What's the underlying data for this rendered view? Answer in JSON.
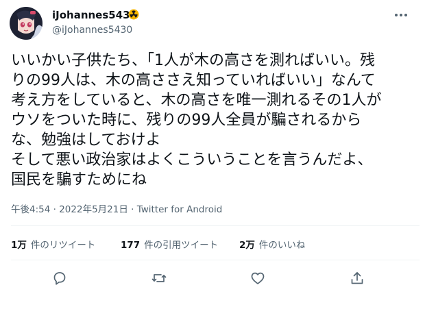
{
  "author": {
    "display_name": "iJohannes5430",
    "handle": "@iJohannes5430",
    "badge_icon": "radioactive-icon"
  },
  "tweet": {
    "lines": [
      "いいかい子供たち、「1人が木の高さを測ればいい。残",
      "りの99人は、木の高ささえ知っていればいい」なんて",
      "考え方をしていると、木の高さを唯一測れるその1人が",
      "ウソをついた時に、残りの99人全員が騙されるから",
      "な、勉強はしておけよ",
      "そして悪い政治家はよくこういうことを言うんだよ、",
      "国民を騙すためにね"
    ]
  },
  "meta": {
    "time": "午後4:54",
    "separator": "·",
    "date": "2022年5月21日",
    "source": "Twitter for Android"
  },
  "stats": {
    "retweets_count": "1万",
    "retweets_label": "件のリツイート",
    "quotes_count": "177",
    "quotes_label": "件の引用ツイート",
    "likes_count": "2万",
    "likes_label": "件のいいね"
  },
  "actions": {
    "reply_icon": "reply-icon",
    "retweet_icon": "retweet-icon",
    "like_icon": "heart-icon",
    "share_icon": "share-icon"
  },
  "colors": {
    "text": "#0f1419",
    "secondary": "#536471",
    "divider": "#eff3f4",
    "badge": "#f4b400"
  }
}
